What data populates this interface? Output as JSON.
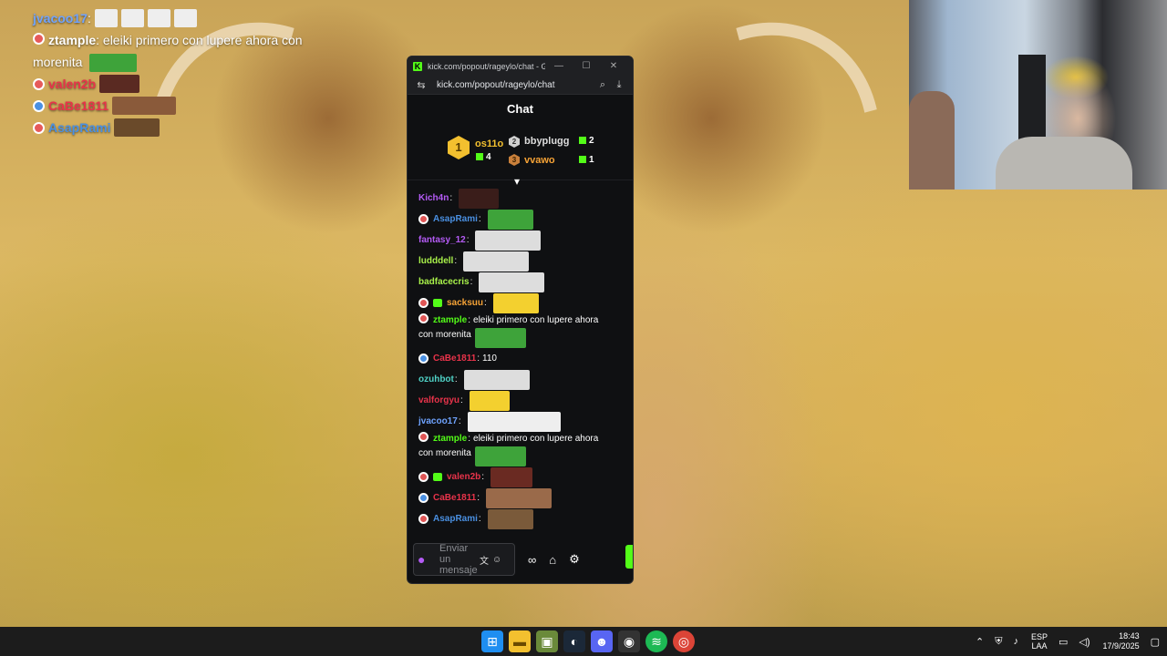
{
  "overlay_chat": [
    {
      "user": "jvacoo17",
      "color": "#6fa3ff",
      "text": "",
      "emotes": 4
    },
    {
      "user": "ztample",
      "color": "#ffffff",
      "text": "eleiki primero con lupere ahora con",
      "text2": "morenita"
    },
    {
      "user": "valen2b",
      "color": "#e8334a",
      "text": ""
    },
    {
      "user": "CaBe1811",
      "color": "#e8334a",
      "text": ""
    },
    {
      "user": "AsapRami",
      "color": "#4a90e2",
      "text": ""
    }
  ],
  "window": {
    "title": "kick.com/popout/rageylo/chat - Goog...",
    "url": "kick.com/popout/rageylo/chat"
  },
  "chat": {
    "header": "Chat",
    "leaderboard": {
      "first": {
        "rank": "1",
        "name": "os11o",
        "count": "4"
      },
      "second": {
        "rank": "2",
        "name": "bbyplugg",
        "count": "2"
      },
      "third": {
        "rank": "3",
        "name": "vvawo",
        "count": "1"
      }
    },
    "messages": [
      {
        "user": "Kich4n",
        "color": "#b45bf5",
        "text": "",
        "emote": "#3a1d1a",
        "ew": 44
      },
      {
        "user": "AsapRami",
        "color": "#4a90e2",
        "text": "",
        "badge": "red",
        "emote": "#3ea33a",
        "ew": 50
      },
      {
        "user": "fantasy_12",
        "color": "#b45bf5",
        "text": "",
        "emote": "#ddd",
        "ew": 72
      },
      {
        "user": "ludddell",
        "color": "#a8f04a",
        "text": "",
        "emote": "#ddd",
        "ew": 72
      },
      {
        "user": "badfacecris",
        "color": "#a8f04a",
        "text": "",
        "emote": "#ddd",
        "ew": 72
      },
      {
        "user": "sacksuu",
        "color": "#f6a336",
        "text": "",
        "badge": "red",
        "badge2": "gift",
        "emote": "#f3d02f",
        "ew": 50
      },
      {
        "user": "ztample",
        "color": "#53fc18",
        "text": "eleiki primero con lupere ahora",
        "text2": "con morenita",
        "badge": "red",
        "emote": "#3ea33a",
        "ew": 56
      },
      {
        "user": "CaBe1811",
        "color": "#e8334a",
        "text": "110",
        "badge": "blue"
      },
      {
        "user": "ozuhbot",
        "color": "#4fd1c5",
        "text": "",
        "emote": "#ddd",
        "ew": 72
      },
      {
        "user": "valforgyu",
        "color": "#e8334a",
        "text": "",
        "emote": "#f3d02f",
        "ew": 44
      },
      {
        "user": "jvacoo17",
        "color": "#6fa3ff",
        "text": "",
        "emote": "#eee",
        "ew": 102
      },
      {
        "user": "ztample",
        "color": "#53fc18",
        "text": "eleiki primero con lupere ahora",
        "text2": "con morenita",
        "badge": "red",
        "emote": "#3ea33a",
        "ew": 56
      },
      {
        "user": "valen2b",
        "color": "#e8334a",
        "text": "",
        "badge": "red",
        "badge2": "gift",
        "emote": "#6a2a22",
        "ew": 46
      },
      {
        "user": "CaBe1811",
        "color": "#e8334a",
        "text": "",
        "badge": "blue",
        "emote": "#9a6a4a",
        "ew": 72
      },
      {
        "user": "AsapRami",
        "color": "#4a90e2",
        "text": "",
        "badge": "red",
        "emote": "#7a5a3a",
        "ew": 50
      }
    ],
    "input_placeholder": "Enviar un mensaje"
  },
  "taskbar": {
    "lang_top": "ESP",
    "lang_bottom": "LAA",
    "time": "18:43",
    "date": "17/9/2025"
  }
}
